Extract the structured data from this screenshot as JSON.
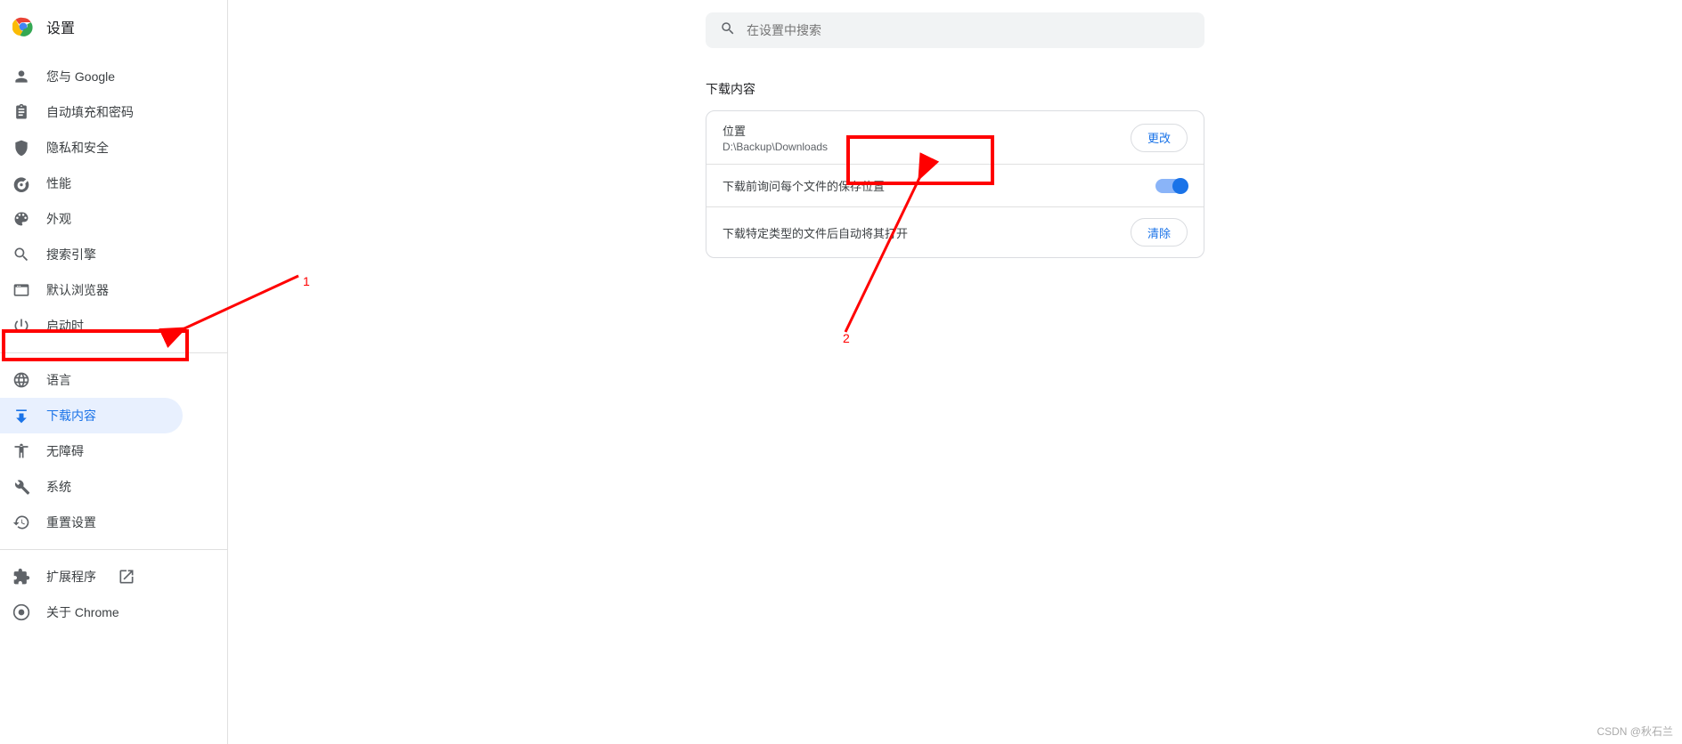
{
  "header": {
    "title": "设置"
  },
  "search": {
    "placeholder": "在设置中搜索"
  },
  "sidebar": {
    "groups": [
      [
        {
          "id": "you-and-google",
          "label": "您与 Google",
          "icon": "person"
        },
        {
          "id": "autofill",
          "label": "自动填充和密码",
          "icon": "assignment"
        },
        {
          "id": "privacy",
          "label": "隐私和安全",
          "icon": "shield"
        },
        {
          "id": "performance",
          "label": "性能",
          "icon": "speed"
        },
        {
          "id": "appearance",
          "label": "外观",
          "icon": "palette"
        },
        {
          "id": "search-engine",
          "label": "搜索引擎",
          "icon": "search"
        },
        {
          "id": "default-browser",
          "label": "默认浏览器",
          "icon": "browser"
        },
        {
          "id": "on-startup",
          "label": "启动时",
          "icon": "power"
        }
      ],
      [
        {
          "id": "languages",
          "label": "语言",
          "icon": "globe"
        },
        {
          "id": "downloads",
          "label": "下载内容",
          "icon": "download",
          "selected": true
        },
        {
          "id": "accessibility",
          "label": "无障碍",
          "icon": "accessibility"
        },
        {
          "id": "system",
          "label": "系统",
          "icon": "wrench"
        },
        {
          "id": "reset",
          "label": "重置设置",
          "icon": "restore"
        }
      ],
      [
        {
          "id": "extensions",
          "label": "扩展程序",
          "icon": "extension",
          "external": true
        },
        {
          "id": "about",
          "label": "关于 Chrome",
          "icon": "chrome"
        }
      ]
    ]
  },
  "main": {
    "section_title": "下载内容",
    "rows": {
      "location": {
        "label": "位置",
        "value": "D:\\Backup\\Downloads",
        "button": "更改"
      },
      "ask_each": {
        "label": "下载前询问每个文件的保存位置",
        "toggle_on": true
      },
      "auto_open": {
        "label": "下载特定类型的文件后自动将其打开",
        "button": "清除"
      }
    }
  },
  "annotations": {
    "label1": "1",
    "label2": "2"
  },
  "watermark": "CSDN @秋石兰"
}
